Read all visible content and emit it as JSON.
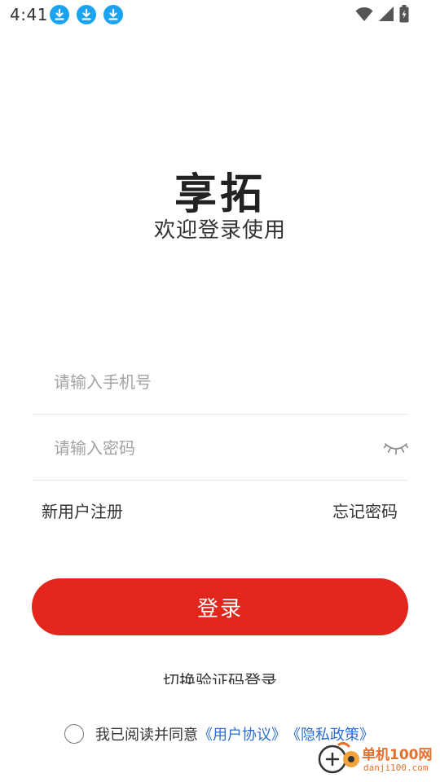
{
  "status_bar": {
    "time": "4:41",
    "notification_icons": [
      "download-icon",
      "download-icon",
      "download-icon"
    ],
    "system_icons": [
      "wifi-icon",
      "signal-icon",
      "battery-icon"
    ]
  },
  "header": {
    "title": "享拓",
    "subtitle": "欢迎登录使用"
  },
  "form": {
    "phone_placeholder": "请输入手机号",
    "password_placeholder": "请输入密码",
    "password_toggle_icon": "eye-closed-icon"
  },
  "links": {
    "register": "新用户注册",
    "forgot": "忘记密码"
  },
  "login_button": "登录",
  "switch_login": "切换验证码登录",
  "agreement": {
    "prefix": "我已阅读并同意",
    "user_agreement": "《用户协议》",
    "privacy_policy": "《隐私政策》"
  },
  "watermark": {
    "text": "单机100网",
    "sub": "danji100.com"
  },
  "colors": {
    "primary": "#e2261c",
    "link": "#2a6fcf",
    "download_badge": "#1aa3f0"
  }
}
